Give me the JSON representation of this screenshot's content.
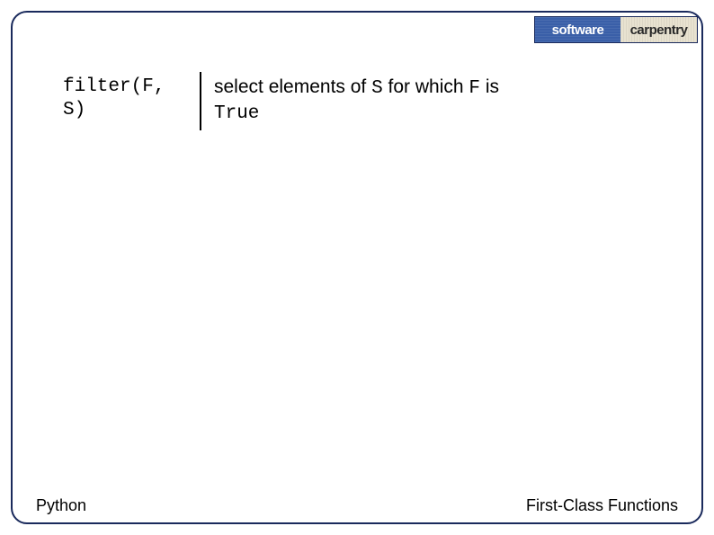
{
  "logo": {
    "left": "software",
    "right": "carpentry"
  },
  "table": {
    "func_line1": "filter(F,",
    "func_line2": "S)",
    "desc_prefix": "select elements of ",
    "desc_code1": "S",
    "desc_mid": " for which ",
    "desc_code2": "F",
    "desc_suffix": " is",
    "desc_line2": "True"
  },
  "footer": {
    "left": "Python",
    "right": "First-Class Functions"
  }
}
